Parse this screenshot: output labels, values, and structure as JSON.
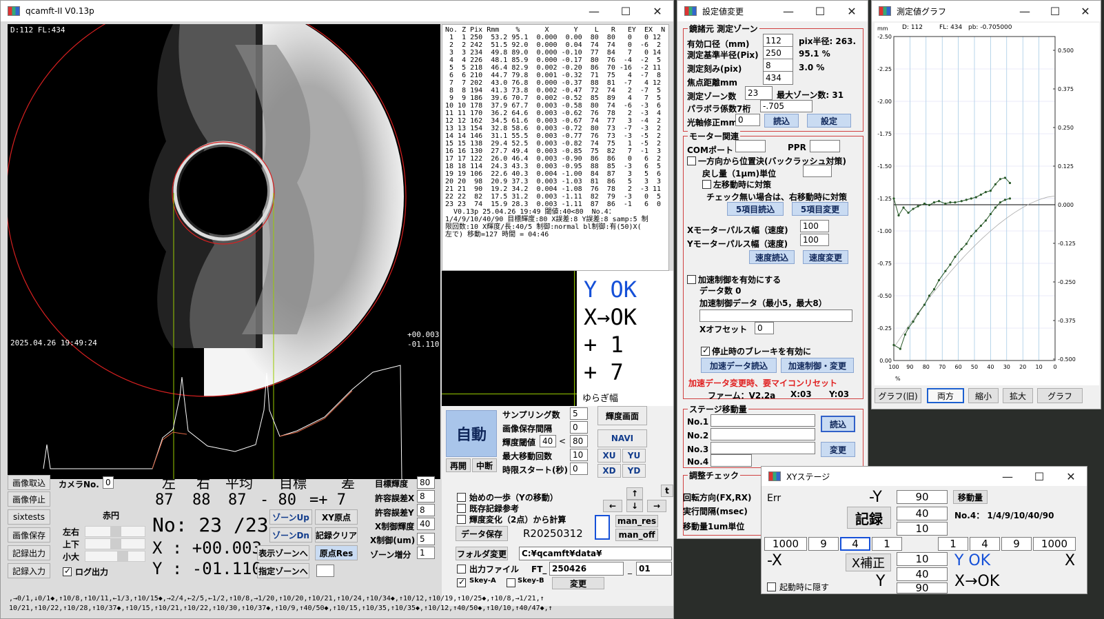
{
  "main": {
    "title": "qcamft-II  V0.13p",
    "overlay_top": "D:112  FL:434",
    "overlay_date": "2025.04.26 19:49:24",
    "overlay_x": "+00.003",
    "overlay_y": "-01.110",
    "table_header": "No. Z Pix Rmm    %      X      Y    L   R   EY  EX  N",
    "table_rows": [
      " 1  1 250  53.2 95.1  0.000  0.00  80  80   0   0 12",
      " 2  2 242  51.5 92.0  0.000  0.04  74  74   0  -6  2",
      " 3  3 234  49.8 89.0  0.000 -0.10  77  84   7   0 14",
      " 4  4 226  48.1 85.9  0.000 -0.17  80  76  -4  -2  5",
      " 5  5 218  46.4 82.9  0.002 -0.20  86  70 -16  -2 11",
      " 6  6 210  44.7 79.8  0.001 -0.32  71  75   4  -7  8",
      " 7  7 202  43.0 76.8  0.000 -0.37  88  81  -7   4 12",
      " 8  8 194  41.3 73.8  0.002 -0.47  72  74   2  -7  5",
      " 9  9 186  39.6 70.7  0.002 -0.52  85  89   4   7  5",
      "10 10 178  37.9 67.7  0.003 -0.58  80  74  -6  -3  6",
      "11 11 170  36.2 64.6  0.003 -0.62  76  78   2  -3  4",
      "12 12 162  34.5 61.6  0.003 -0.67  74  77   3  -4  2",
      "13 13 154  32.8 58.6  0.003 -0.72  80  73  -7  -3  2",
      "14 14 146  31.1 55.5  0.003 -0.77  76  73  -3  -5  2",
      "15 15 138  29.4 52.5  0.003 -0.82  74  75   1  -5  2",
      "16 16 130  27.7 49.4  0.003 -0.85  75  82   7  -1  3",
      "17 17 122  26.0 46.4  0.003 -0.90  86  86   0   6  2",
      "18 18 114  24.3 43.3  0.003 -0.95  88  85  -3   6  5",
      "19 19 106  22.6 40.3  0.004 -1.00  84  87   3   5  6",
      "20 20  98  20.9 37.3  0.003 -1.03  81  86   5   3  3",
      "21 21  90  19.2 34.2  0.004 -1.08  76  78   2  -3 11",
      "22 22  82  17.5 31.2  0.003 -1.11  82  79  -3   0  5",
      "23 23  74  15.9 28.3  0.003 -1.11  87  86  -1   6  0"
    ],
    "table_footer": [
      "  V0.13p 25.04.26 19:49 閾値:40<80  No.4：",
      "1/4/9/10/40/90 目標輝度:80 X誤差:8 Y誤差:8 samp:5 制",
      "限回数:10 X輝度/長:40/5 制御:normal bl制御:有(50)X(",
      "左で) 移動=127 時間 = 04:46"
    ],
    "status": [
      "Y OK",
      "X→OK",
      "+    1",
      "+    7"
    ],
    "yuragi": "ゆらぎ幅",
    "btn_capture": "画像取込",
    "btn_stop": "画像停止",
    "btn_sixtests": "sixtests",
    "btn_save": "画像保存",
    "btn_out": "記録出力",
    "btn_in": "記録入力",
    "camera_label": "カメラNo.",
    "camera_val": "0",
    "akaen": "赤円",
    "sl_lr": "左右",
    "sl_ud": "上下",
    "sl_size": "小大",
    "log_out": "ログ出力",
    "col_left": "左",
    "col_right": "右",
    "col_avg": "平均",
    "col_target": "目標",
    "col_diff": "差",
    "v_left": "87",
    "v_right": "88",
    "v_avg": "87",
    "v_target": "- 80",
    "v_diff": "=+ 7",
    "no_display": "No: 23 /23",
    "x_display": "X : +00.003",
    "y_display": "Y : -01.110",
    "btn_zone_up": "ゾーンUp",
    "btn_xy_origin": "XY原点",
    "btn_zone_dn": "ゾーンDn",
    "btn_rec_clear": "記録クリア",
    "btn_show_zone": "表示ゾーンへ",
    "btn_origin_res": "原点Res",
    "btn_sel_zone": "指定ゾーンへ",
    "lbl_target_bri": "目標輝度",
    "v_target_bri": "80",
    "lbl_tol_x": "許容誤差X",
    "v_tol_x": "8",
    "lbl_tol_y": "許容誤差Y",
    "v_tol_y": "8",
    "lbl_x_ctrl": "X制御輝度",
    "v_x_ctrl": "40",
    "lbl_x_ctrl_um": "X制御(um)",
    "v_x_ctrl_um": "5",
    "lbl_zone_inc": "ゾーン増分",
    "v_zone_inc": "1",
    "btn_auto": "自動",
    "btn_resume": "再開",
    "btn_interrupt": "中断",
    "lbl_sampling": "サンプリング数",
    "v_sampling": "5",
    "lbl_img_interval": "画像保存間隔",
    "v_img_interval": "0",
    "lbl_bri_thresh": "輝度閾値",
    "v_bri_thresh_a": "40",
    "v_bri_thresh_lt": "<",
    "v_bri_thresh_b": "80",
    "lbl_max_move": "最大移動回数",
    "v_max_move": "10",
    "lbl_timer": "時限スタート(秒)",
    "v_timer": "0",
    "btn_bri_screen": "輝度画面",
    "btn_navi": "NAVI",
    "btn_xu": "XU",
    "btn_yu": "YU",
    "btn_xd": "XD",
    "btn_yd": "YD",
    "btn_t": "t",
    "btn_man_res": "man_res",
    "btn_man_off": "man_off",
    "chk_first": "始めの一歩（Yの移動）",
    "chk_existing": "既存記録参考",
    "chk_bri_change": "輝度変化（2点）から計算",
    "btn_data_save": "データ保存",
    "r_name": "R20250312",
    "btn_folder": "フォルダ変更",
    "folder_path": "C:¥qcamft¥data¥",
    "chk_output": "出力ファイル",
    "ft_label": "FT_",
    "ft_val": "250426",
    "ft_sep": "_",
    "ft_idx": "01",
    "skey_a": "Skey-A",
    "skey_b": "Skey-B",
    "btn_change": "変更",
    "seq_line1": ",→0/1,↓0/1◆,↑10/8,↑10/11,←1/3,↑10/15◆,→2/4,←2/5,←1/2,↑10/8,→1/20,↑10/20,↑10/21,↑10/24,↑10/34◆,↑10/12,↑10/19,↑10/25◆,↑10/8,→1/21,↑",
    "seq_line2": "10/21,↑10/22,↑10/28,↑10/37◆,↑10/15,↑10/21,↑10/22,↑10/30,↑10/37◆,↑10/9,↑40/50◆,↑10/15,↑10/35,↑10/35◆,↑10/12,↑40/50◆,↑10/10,↑40/47◆,↑",
    "arrows": {
      "up": "↑",
      "left": "←",
      "down": "↓",
      "right": "→"
    }
  },
  "settings": {
    "title": "設定値変更",
    "grp_mirror": "鏡諸元 測定ゾーン",
    "eff_dia": "有効口径（mm)",
    "eff_dia_v": "112",
    "pix_r": "pix半径: 263.",
    "ref_r": "測定基準半径(Pix)",
    "ref_r_v": "250",
    "pct": "95.1 %",
    "step": "測定刻み(pix)",
    "step_v": "8",
    "step_pct": "3.0 %",
    "focal": "焦点距離mm",
    "focal_v": "434",
    "zones": "測定ゾーン数",
    "zones_v": "23",
    "max_zone": "最大ゾーン数:  31",
    "parabola": "パラボラ係数7桁",
    "parabola_v": "-.705",
    "axis": "光軸修正mm",
    "axis_v": "0",
    "btn_read": "読込",
    "btn_set": "設定",
    "grp_motor": "モーター関連",
    "com": "COMポート",
    "ppr": "PPR",
    "oneway": "一方向から位置決(バックラッシュ対策)",
    "return": "戻し量（1μm)単位",
    "left_move": "左移動時に対策",
    "note": "チェック無い場合は、右移動時に対策",
    "btn_5read": "5項目読込",
    "btn_5change": "5項目変更",
    "x_pulse": "Xモーターパルス幅（速度)",
    "x_pulse_v": "100",
    "y_pulse": "Yモーターパルス幅（速度)",
    "y_pulse_v": "100",
    "btn_speed_read": "速度読込",
    "btn_speed_change": "速度変更",
    "accel_enable": "加速制御を有効にする",
    "data_count": "データ数  0",
    "accel_data": "加速制御データ（最小5，最大8）",
    "x_offset": "Xオフセット",
    "x_offset_v": "0",
    "brake": "停止時のブレーキを有効に",
    "btn_accel_read": "加速データ読込",
    "btn_accel_change": "加速制御・変更",
    "warn": "加速データ変更時、要マイコンリセット",
    "firmware": "ファーム：V2.2a",
    "fx": "X:03",
    "fy": "Y:03",
    "grp_stage": "ステージ移動量",
    "no1": "No.1",
    "no2": "No.2",
    "no3": "No.3",
    "no4": "No.4",
    "btn_stage_read": "読込",
    "btn_stage_change": "変更",
    "grp_adjust": "調整チェック",
    "rot": "回転方向(FX,RX)",
    "interval": "実行間隔(msec)",
    "move_unit": "移動量1um単位"
  },
  "graph": {
    "title": "測定値グラフ",
    "mm": "mm",
    "d": "D: 112",
    "fl": "FL: 434",
    "pb": "pb: -0.705000",
    "pct": "%",
    "left_ticks": [
      "-2.50",
      "-2.25",
      "-2.00",
      "-1.75",
      "-1.50",
      "-1.25",
      "-1.00",
      "-0.75",
      "-0.50",
      "-0.25",
      "0.00"
    ],
    "right_ticks": [
      "0.500",
      "0.375",
      "0.250",
      "0.125",
      "0.000",
      "-0.125",
      "-0.250",
      "-0.375",
      "-0.500"
    ],
    "x_ticks": [
      "100",
      "90",
      "80",
      "70",
      "60",
      "50",
      "40",
      "30",
      "20",
      "10",
      "0"
    ],
    "tabs": [
      "グラフ(旧)",
      "両方",
      "縮小",
      "拡大",
      "グラフ"
    ],
    "active_tab": 1
  },
  "xy": {
    "title": "XYステージ",
    "err": "Err",
    "minus_y": "-Y",
    "v90a": "90",
    "btn_move": "移動量",
    "btn_record": "記録",
    "v40a": "40",
    "info": "No.4：  1/4/9/10/40/90",
    "v10a": "10",
    "l1000": "1000",
    "l9": "9",
    "l4": "4",
    "l1": "1",
    "r1": "1",
    "r4": "4",
    "r9": "9",
    "r1000": "1000",
    "minus_x": "-X",
    "btn_xcorr": "X補正",
    "v10b": "10",
    "v40b": "40",
    "yok": "Y OK",
    "x": "X",
    "hide": "起動時に隠す",
    "y": "Y",
    "v90b": "90",
    "xok": "X→OK"
  },
  "chart_data": {
    "type": "line",
    "title": "",
    "xlabel": "%",
    "ylabel": "mm",
    "xlim": [
      100,
      0
    ],
    "ylim": [
      -2.5,
      0
    ],
    "y2lim": [
      -0.5,
      0.5
    ],
    "series": [
      {
        "values": [
          [
            100,
            -1.25
          ],
          [
            97,
            -1.12
          ],
          [
            94,
            -1.18
          ],
          [
            91,
            -1.14
          ],
          [
            88,
            -1.17
          ],
          [
            85,
            -1.19
          ],
          [
            81,
            -1.21
          ],
          [
            78,
            -1.2
          ],
          [
            75,
            -1.22
          ],
          [
            72,
            -1.23
          ],
          [
            68,
            -1.21
          ],
          [
            65,
            -1.22
          ],
          [
            62,
            -1.22
          ],
          [
            58,
            -1.23
          ],
          [
            55,
            -1.24
          ],
          [
            52,
            -1.25
          ],
          [
            49,
            -1.26
          ],
          [
            46,
            -1.28
          ],
          [
            43,
            -1.3
          ],
          [
            40,
            -1.31
          ],
          [
            37,
            -1.36
          ],
          [
            34,
            -1.4
          ],
          [
            31,
            -1.41
          ],
          [
            28,
            -1.37
          ]
        ]
      },
      {
        "values": [
          [
            100,
            -0.12
          ],
          [
            96,
            -0.09
          ],
          [
            93,
            -0.2
          ],
          [
            91,
            -0.25
          ],
          [
            88,
            -0.3
          ],
          [
            85,
            -0.36
          ],
          [
            81,
            -0.43
          ],
          [
            78,
            -0.5
          ],
          [
            75,
            -0.55
          ],
          [
            72,
            -0.62
          ],
          [
            68,
            -0.69
          ],
          [
            65,
            -0.74
          ],
          [
            62,
            -0.8
          ],
          [
            58,
            -0.86
          ],
          [
            55,
            -0.9
          ],
          [
            52,
            -0.96
          ],
          [
            49,
            -1.0
          ],
          [
            46,
            -1.04
          ],
          [
            43,
            -1.08
          ],
          [
            40,
            -1.13
          ],
          [
            37,
            -1.18
          ],
          [
            34,
            -1.22
          ],
          [
            31,
            -1.24
          ],
          [
            28,
            -1.25
          ]
        ]
      }
    ]
  }
}
